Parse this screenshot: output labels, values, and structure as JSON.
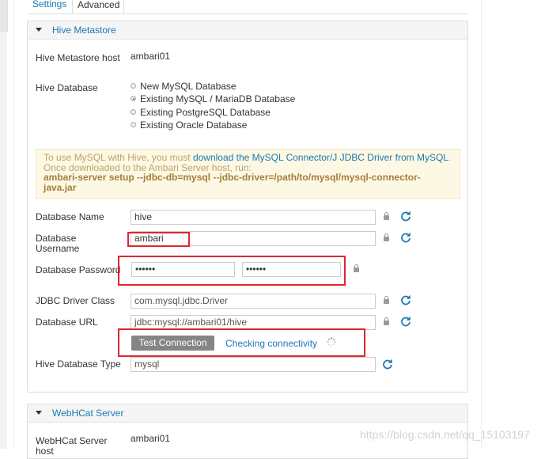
{
  "tabs": [
    {
      "label": "Settings"
    },
    {
      "label": "Advanced"
    }
  ],
  "hive_panel": {
    "title": "Hive Metastore",
    "metastore_host_label": "Hive Metastore host",
    "metastore_host_value": "ambari01",
    "database_label": "Hive Database",
    "database_options": [
      {
        "label": "New MySQL Database",
        "selected": false
      },
      {
        "label": "Existing MySQL / MariaDB Database",
        "selected": true
      },
      {
        "label": "Existing PostgreSQL Database",
        "selected": false
      },
      {
        "label": "Existing Oracle Database",
        "selected": false
      }
    ],
    "alert": {
      "prefix": "To use MySQL with Hive, you must ",
      "link": "download the MySQL Connector/J JDBC Driver from MySQL",
      "middle": ". Once downloaded to the Ambari Server host, run:",
      "command": "ambari-server setup --jdbc-db=mysql --jdbc-driver=/path/to/mysql/mysql-connector-java.jar"
    },
    "fields": {
      "db_name_label": "Database Name",
      "db_name_value": "hive",
      "db_user_label": "Database Username",
      "db_user_value": "ambari",
      "db_password_label": "Database Password",
      "db_password_value": "••••••",
      "db_password_confirm": "••••••",
      "jdbc_class_label": "JDBC Driver Class",
      "jdbc_class_value": "com.mysql.jdbc.Driver",
      "db_url_label": "Database URL",
      "db_url_value": "jdbc:mysql://ambari01/hive",
      "db_type_label": "Hive Database Type",
      "db_type_value": "mysql"
    },
    "test_button": "Test Connection",
    "checking_text": "Checking connectivity"
  },
  "webhcat_panel": {
    "title": "WebHCat Server",
    "host_label": "WebHCat Server host",
    "host_value": "ambari01"
  },
  "watermark": "https://blog.csdn.net/qq_15103197",
  "colors": {
    "link": "#1b78b5",
    "annotation_red": "#e0262b",
    "alert_bg": "#fcf8e3",
    "button_gray": "#858585"
  },
  "icons": [
    "lock-icon",
    "refresh-icon",
    "caret-down-icon",
    "spinner-icon"
  ]
}
